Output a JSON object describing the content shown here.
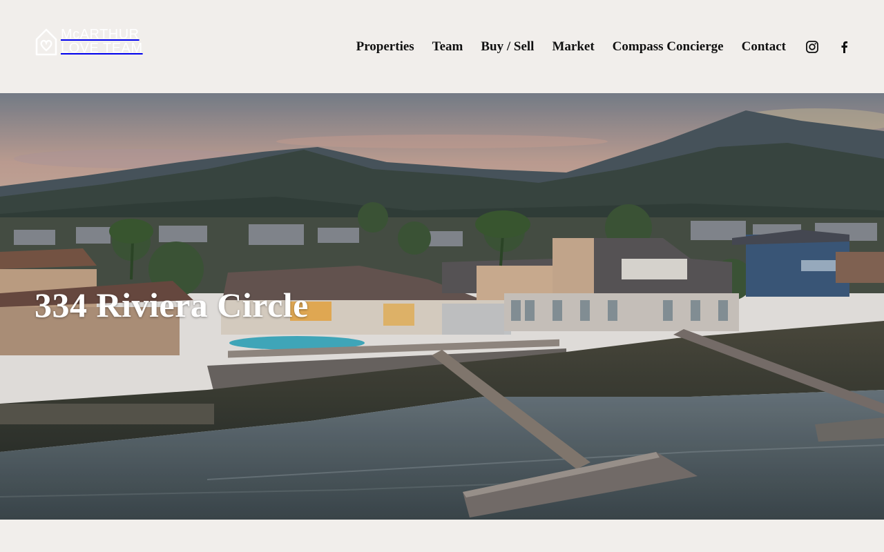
{
  "brand": {
    "line1": "McARTHUR",
    "line2": "LOVE TEAM"
  },
  "nav": {
    "items": [
      {
        "label": "Properties"
      },
      {
        "label": "Team"
      },
      {
        "label": "Buy / Sell"
      },
      {
        "label": "Market"
      },
      {
        "label": "Compass Concierge"
      },
      {
        "label": "Contact"
      }
    ],
    "social": [
      "instagram-icon",
      "facebook-icon"
    ]
  },
  "hero": {
    "title": "334 Riviera Circle",
    "image": "aerial-waterfront-homes-with-docks-and-mountains-at-dusk"
  },
  "colors": {
    "background": "#f1eeeb",
    "nav_text": "#111111",
    "hero_title": "#ffffff"
  }
}
